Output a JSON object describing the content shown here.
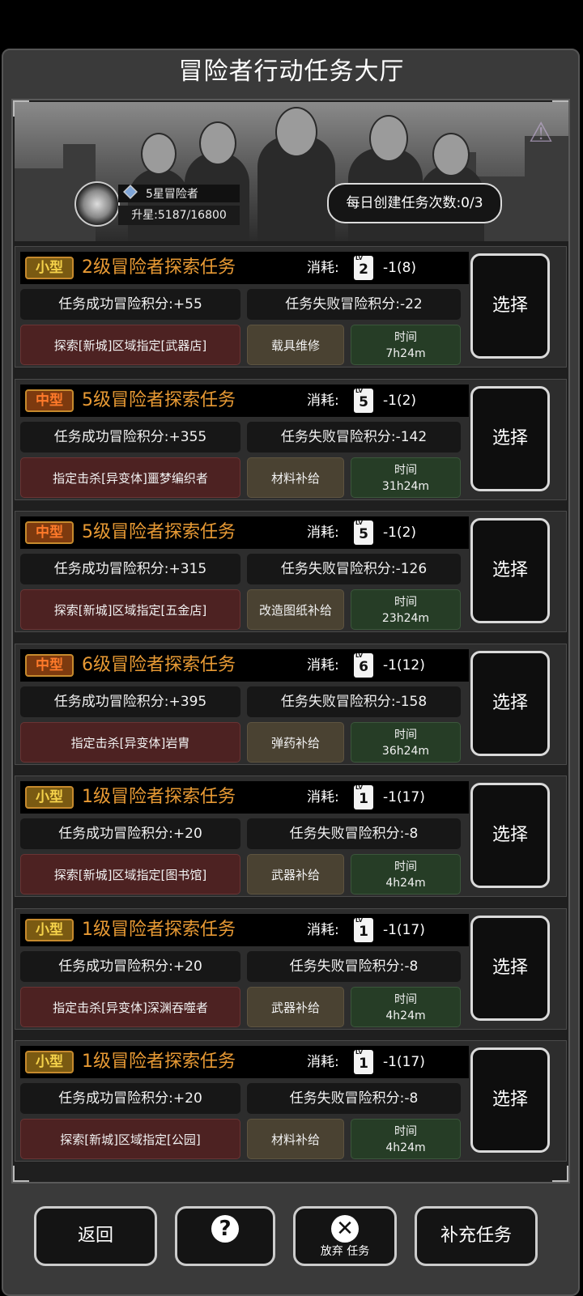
{
  "title": "冒险者行动任务大厅",
  "rank": {
    "label": "5星冒险者",
    "progress_text": "升星:5187/16800",
    "progress_fraction": 0.309
  },
  "daily": {
    "text": "每日创建任务次数:0/3"
  },
  "tasks": [
    {
      "size": "小型",
      "size_class": "s",
      "name": "2级冒险者探索任务",
      "cost_label": "消耗:",
      "lv": "2",
      "cost": "-1(8)",
      "success": "任务成功冒险积分:+55",
      "fail": "任务失败冒险积分:-22",
      "location": "探索[新城]区域指定[武器店]",
      "reward": "载具维修",
      "time_label": "时间",
      "time": "7h24m",
      "select": "选择"
    },
    {
      "size": "中型",
      "size_class": "m",
      "name": "5级冒险者探索任务",
      "cost_label": "消耗:",
      "lv": "5",
      "cost": "-1(2)",
      "success": "任务成功冒险积分:+355",
      "fail": "任务失败冒险积分:-142",
      "location": "指定击杀[异变体]噩梦编织者",
      "reward": "材料补给",
      "time_label": "时间",
      "time": "31h24m",
      "select": "选择"
    },
    {
      "size": "中型",
      "size_class": "m",
      "name": "5级冒险者探索任务",
      "cost_label": "消耗:",
      "lv": "5",
      "cost": "-1(2)",
      "success": "任务成功冒险积分:+315",
      "fail": "任务失败冒险积分:-126",
      "location": "探索[新城]区域指定[五金店]",
      "reward": "改造图纸补给",
      "time_label": "时间",
      "time": "23h24m",
      "select": "选择"
    },
    {
      "size": "中型",
      "size_class": "m",
      "name": "6级冒险者探索任务",
      "cost_label": "消耗:",
      "lv": "6",
      "cost": "-1(12)",
      "success": "任务成功冒险积分:+395",
      "fail": "任务失败冒险积分:-158",
      "location": "指定击杀[异变体]岩胄",
      "reward": "弹药补给",
      "time_label": "时间",
      "time": "36h24m",
      "select": "选择"
    },
    {
      "size": "小型",
      "size_class": "s",
      "name": "1级冒险者探索任务",
      "cost_label": "消耗:",
      "lv": "1",
      "cost": "-1(17)",
      "success": "任务成功冒险积分:+20",
      "fail": "任务失败冒险积分:-8",
      "location": "探索[新城]区域指定[图书馆]",
      "reward": "武器补给",
      "time_label": "时间",
      "time": "4h24m",
      "select": "选择"
    },
    {
      "size": "小型",
      "size_class": "s",
      "name": "1级冒险者探索任务",
      "cost_label": "消耗:",
      "lv": "1",
      "cost": "-1(17)",
      "success": "任务成功冒险积分:+20",
      "fail": "任务失败冒险积分:-8",
      "location": "指定击杀[异变体]深渊吞噬者",
      "reward": "武器补给",
      "time_label": "时间",
      "time": "4h24m",
      "select": "选择"
    },
    {
      "size": "小型",
      "size_class": "s",
      "name": "1级冒险者探索任务",
      "cost_label": "消耗:",
      "lv": "1",
      "cost": "-1(17)",
      "success": "任务成功冒险积分:+20",
      "fail": "任务失败冒险积分:-8",
      "location": "探索[新城]区域指定[公园]",
      "reward": "材料补给",
      "time_label": "时间",
      "time": "4h24m",
      "select": "选择"
    }
  ],
  "bottom": {
    "back": "返回",
    "help_icon": "question-map-icon",
    "abandon": "放弃 任务",
    "abandon_icon": "x-circle-icon",
    "refill": "补充任务"
  }
}
